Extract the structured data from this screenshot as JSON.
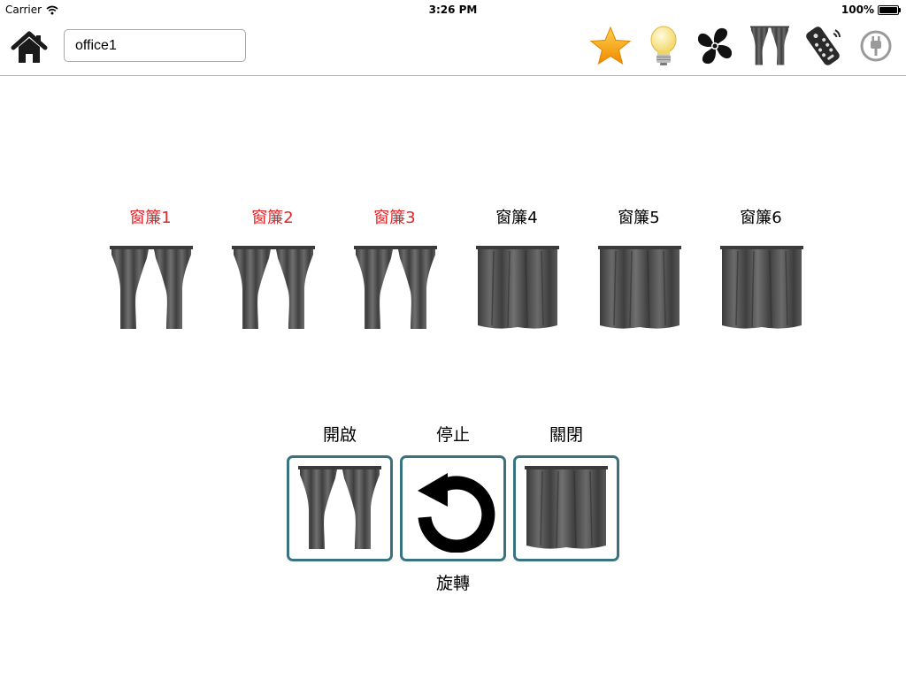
{
  "status_bar": {
    "carrier": "Carrier",
    "time": "3:26 PM",
    "battery": "100%"
  },
  "toolbar": {
    "room_name": "office1",
    "icons": [
      "home-icon",
      "star-icon",
      "lightbulb-icon",
      "fan-icon",
      "curtain-icon",
      "remote-icon",
      "power-plug-icon"
    ]
  },
  "curtains": [
    {
      "label": "窗簾1",
      "state": "open",
      "selected": true
    },
    {
      "label": "窗簾2",
      "state": "open",
      "selected": true
    },
    {
      "label": "窗簾3",
      "state": "open",
      "selected": true
    },
    {
      "label": "窗簾4",
      "state": "closed",
      "selected": false
    },
    {
      "label": "窗簾5",
      "state": "closed",
      "selected": false
    },
    {
      "label": "窗簾6",
      "state": "closed",
      "selected": false
    }
  ],
  "controls": {
    "open_label": "開啟",
    "stop_label": "停止",
    "close_label": "關閉",
    "rotate_label": "旋轉"
  },
  "colors": {
    "selected_label": "#e0262a",
    "button_border": "#3a7380",
    "curtain_fabric": "#4a4a4a",
    "star": "#f5a623",
    "bulb": "#f6e27a"
  }
}
